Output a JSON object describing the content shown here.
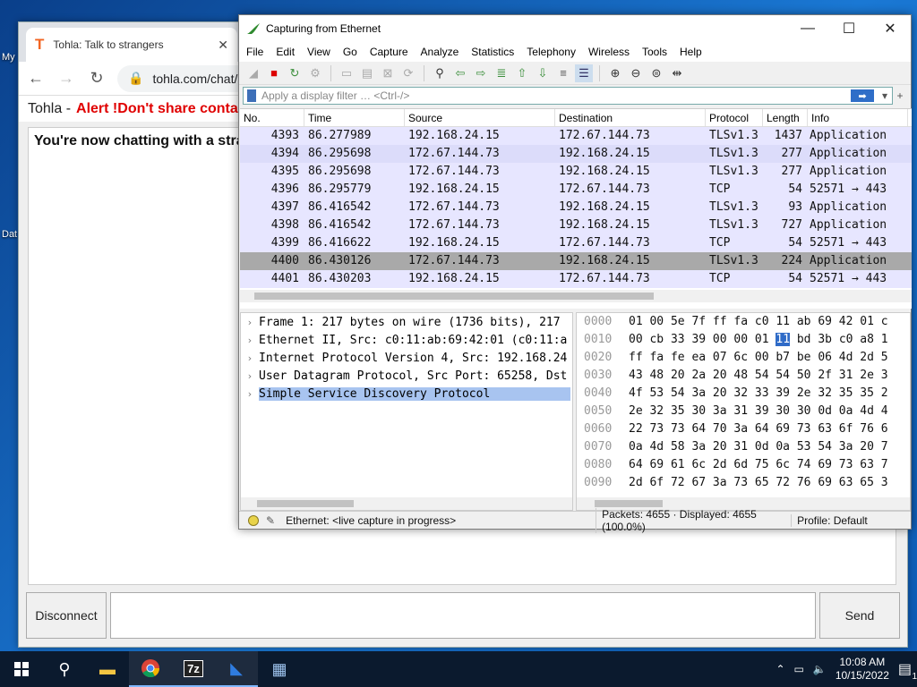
{
  "desktop": {
    "icon_labels": [
      "My",
      "Dat"
    ]
  },
  "chrome": {
    "tab_title": "Tohla: Talk to strangers",
    "tab_favicon": "T",
    "url": "tohla.com/chat/",
    "page_title": "Tohla -",
    "alert": "Alert !Don't share conta",
    "chat_message": "You're now chatting with a stra",
    "disconnect_label": "Disconnect",
    "send_label": "Send"
  },
  "wireshark": {
    "title": "Capturing from Ethernet",
    "menu": [
      "File",
      "Edit",
      "View",
      "Go",
      "Capture",
      "Analyze",
      "Statistics",
      "Telephony",
      "Wireless",
      "Tools",
      "Help"
    ],
    "filter_placeholder": "Apply a display filter … <Ctrl-/>",
    "columns": [
      "No.",
      "Time",
      "Source",
      "Destination",
      "Protocol",
      "Length",
      "Info"
    ],
    "packets": [
      {
        "no": "4393",
        "time": "86.277989",
        "src": "192.168.24.15",
        "dst": "172.67.144.73",
        "proto": "TLSv1.3",
        "len": "1437",
        "info": "Application"
      },
      {
        "no": "4394",
        "time": "86.295698",
        "src": "172.67.144.73",
        "dst": "192.168.24.15",
        "proto": "TLSv1.3",
        "len": "277",
        "info": "Application"
      },
      {
        "no": "4395",
        "time": "86.295698",
        "src": "172.67.144.73",
        "dst": "192.168.24.15",
        "proto": "TLSv1.3",
        "len": "277",
        "info": "Application"
      },
      {
        "no": "4396",
        "time": "86.295779",
        "src": "192.168.24.15",
        "dst": "172.67.144.73",
        "proto": "TCP",
        "len": "54",
        "info": "52571 → 443"
      },
      {
        "no": "4397",
        "time": "86.416542",
        "src": "172.67.144.73",
        "dst": "192.168.24.15",
        "proto": "TLSv1.3",
        "len": "93",
        "info": "Application"
      },
      {
        "no": "4398",
        "time": "86.416542",
        "src": "172.67.144.73",
        "dst": "192.168.24.15",
        "proto": "TLSv1.3",
        "len": "727",
        "info": "Application"
      },
      {
        "no": "4399",
        "time": "86.416622",
        "src": "192.168.24.15",
        "dst": "172.67.144.73",
        "proto": "TCP",
        "len": "54",
        "info": "52571 → 443"
      },
      {
        "no": "4400",
        "time": "86.430126",
        "src": "172.67.144.73",
        "dst": "192.168.24.15",
        "proto": "TLSv1.3",
        "len": "224",
        "info": "Application"
      },
      {
        "no": "4401",
        "time": "86.430203",
        "src": "192.168.24.15",
        "dst": "172.67.144.73",
        "proto": "TCP",
        "len": "54",
        "info": "52571 → 443"
      }
    ],
    "details": [
      "Frame 1: 217 bytes on wire (1736 bits), 217",
      "Ethernet II, Src: c0:11:ab:69:42:01 (c0:11:a",
      "Internet Protocol Version 4, Src: 192.168.24",
      "User Datagram Protocol, Src Port: 65258, Dst",
      "Simple Service Discovery Protocol"
    ],
    "hex": [
      {
        "off": "0000",
        "pre": "01 00 5e 7f ff fa c0 11",
        "hl": "",
        "post": "  ab 69 42 01 c"
      },
      {
        "off": "0010",
        "pre": "00 cb 33 39 00 00 01 ",
        "hl": "11",
        "post": "  bd 3b c0 a8 1"
      },
      {
        "off": "0020",
        "pre": "ff fa fe ea 07 6c 00 b7",
        "hl": "",
        "post": "  be 06 4d 2d 5"
      },
      {
        "off": "0030",
        "pre": "43 48 20 2a 20 48 54 54",
        "hl": "",
        "post": "  50 2f 31 2e 3"
      },
      {
        "off": "0040",
        "pre": "4f 53 54 3a 20 32 33 39",
        "hl": "",
        "post": "  2e 32 35 35 2"
      },
      {
        "off": "0050",
        "pre": "2e 32 35 30 3a 31 39 30",
        "hl": "",
        "post": "  30 0d 0a 4d 4"
      },
      {
        "off": "0060",
        "pre": "22 73 73 64 70 3a 64 69",
        "hl": "",
        "post": "  73 63 6f 76 6"
      },
      {
        "off": "0070",
        "pre": "0a 4d 58 3a 20 31 0d 0a",
        "hl": "",
        "post": "  53 54 3a 20 7"
      },
      {
        "off": "0080",
        "pre": "64 69 61 6c 2d 6d 75 6c",
        "hl": "",
        "post": "  74 69 73 63 7"
      },
      {
        "off": "0090",
        "pre": "2d 6f 72 67 3a 73 65 72",
        "hl": "",
        "post": "  76 69 63 65 3"
      }
    ],
    "status_capture": "Ethernet: <live capture in progress>",
    "status_packets": "Packets: 4655 · Displayed: 4655 (100.0%)",
    "status_profile": "Profile: Default"
  },
  "taskbar": {
    "time": "10:08 AM",
    "date": "10/15/2022",
    "notifications": "1"
  }
}
